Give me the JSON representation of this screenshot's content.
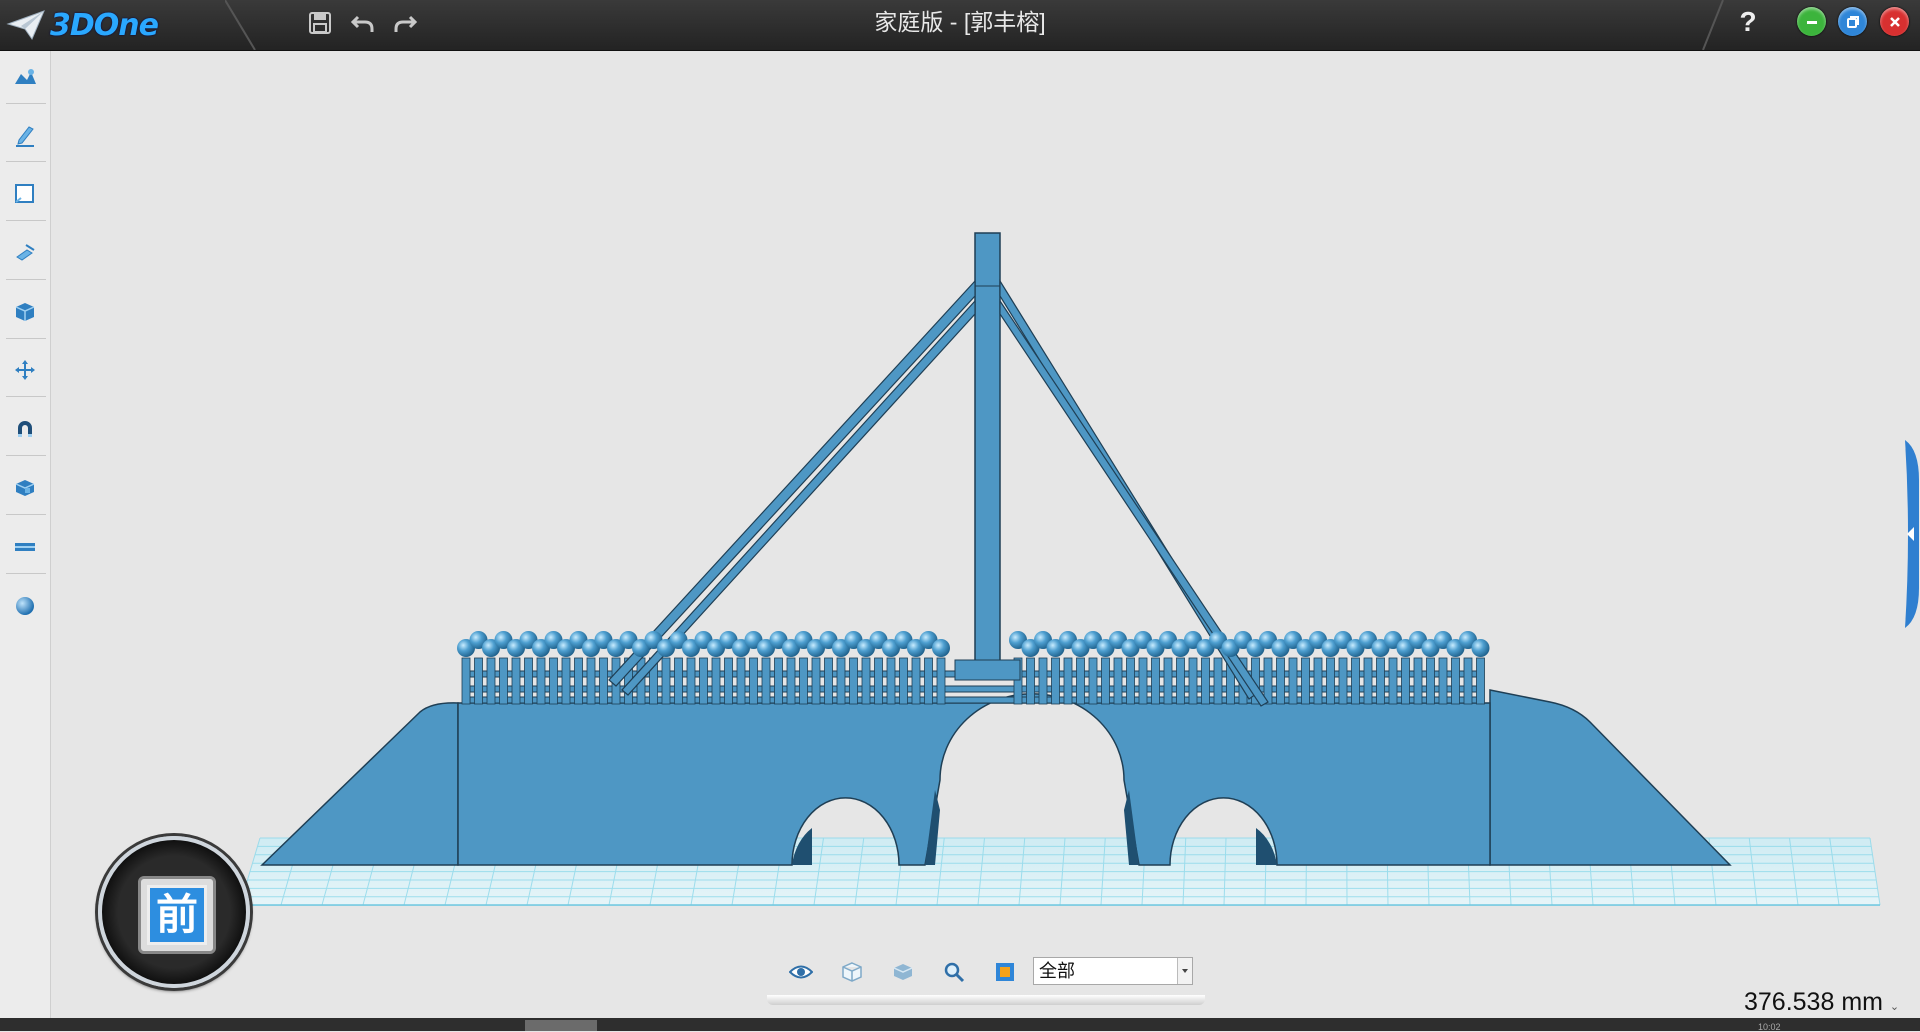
{
  "app": {
    "brand": "3DOne",
    "window_title": "家庭版 - [郭丰榕]",
    "help_label": "?"
  },
  "colors": {
    "accent": "#2aa8ff",
    "model": "#4e97c4",
    "model_dark": "#1f5f86",
    "grid": "#8cd8ea",
    "minimize": "#3cb43c",
    "restore": "#2f86d8",
    "close": "#d83030"
  },
  "quick_toolbar": [
    {
      "name": "save",
      "icon": "save-icon"
    },
    {
      "name": "undo",
      "icon": "undo-icon"
    },
    {
      "name": "redo",
      "icon": "redo-icon"
    }
  ],
  "left_toolbar": [
    {
      "name": "basic-solid",
      "icon": "basic-solid-icon"
    },
    {
      "name": "sketch",
      "icon": "pen-icon"
    },
    {
      "name": "sketch-edit",
      "icon": "square-icon"
    },
    {
      "name": "feature-modeling",
      "icon": "brush-icon"
    },
    {
      "name": "special-feature",
      "icon": "cube-icon"
    },
    {
      "name": "basic-edit",
      "icon": "move-icon"
    },
    {
      "name": "auto-snap",
      "icon": "magnet-icon"
    },
    {
      "name": "combine-edit",
      "icon": "box-icon"
    },
    {
      "name": "distance-measure",
      "icon": "ruler-icon"
    },
    {
      "name": "material-render",
      "icon": "sphere-icon"
    }
  ],
  "viewcube": {
    "face_label": "前"
  },
  "bottom_toolbar": {
    "icons": [
      "eye-icon",
      "wireframe-cube-icon",
      "solid-cube-icon",
      "zoom-icon",
      "fit-view-icon"
    ],
    "filter_value": "全部"
  },
  "measurement": {
    "value": "376.538 mm",
    "suffix": "⌄"
  },
  "status": {
    "text": "10:02"
  }
}
